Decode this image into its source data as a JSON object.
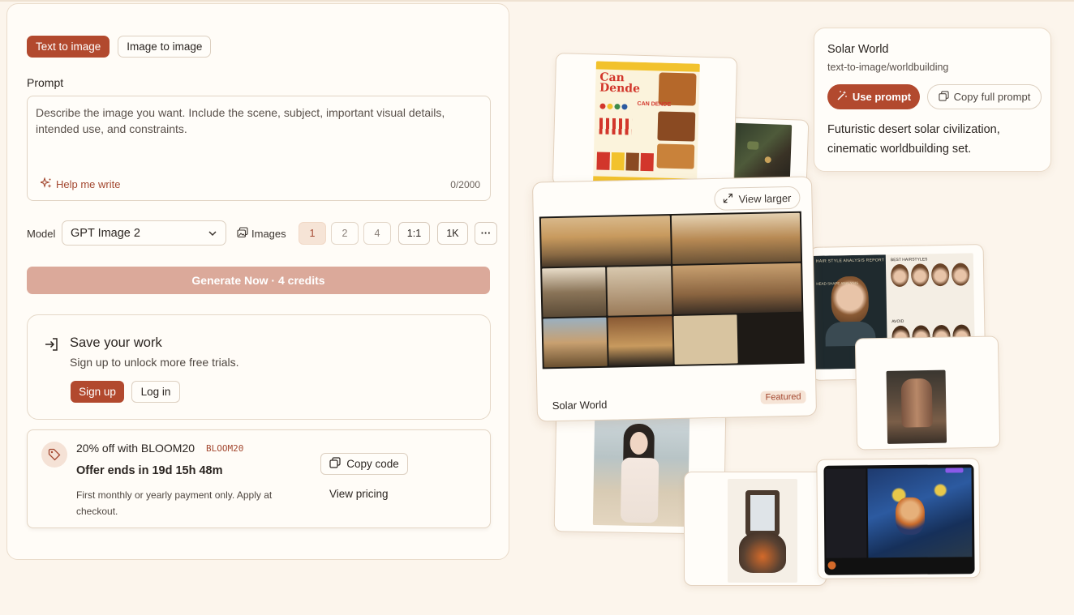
{
  "tabs": [
    {
      "label": "Text to image",
      "active": true
    },
    {
      "label": "Image to image",
      "active": false
    }
  ],
  "prompt": {
    "label": "Prompt",
    "placeholder": "Describe the image you want. Include the scene, subject, important visual details, intended use, and constraints.",
    "help_label": "Help me write",
    "counter": "0/2000"
  },
  "model": {
    "label": "Model",
    "selected": "GPT Image 2",
    "images_label": "Images",
    "counts": [
      "1",
      "2",
      "4"
    ],
    "selected_count": "1",
    "aspect": "1:1",
    "resolution": "1K",
    "more": "···"
  },
  "generate": {
    "label": "Generate Now · 4 credits"
  },
  "save_card": {
    "title": "Save your work",
    "subtitle": "Sign up to unlock more free trials.",
    "signup_label": "Sign up",
    "login_label": "Log in"
  },
  "promo": {
    "title": "20% off with BLOOM20",
    "code": "BLOOM20",
    "ends": "Offer ends in 19d 15h 48m",
    "note": "First monthly or yearly payment only. Apply at checkout.",
    "copy_label": "Copy code",
    "pricing_label": "View pricing"
  },
  "gallery": {
    "featured": {
      "title": "Solar World",
      "badge": "Featured",
      "view_larger": "View larger"
    },
    "poster_lettering": [
      "Can Dende",
      "CAN DENDE"
    ],
    "hair_lettering": [
      "HAIR STYLE ANALYSIS REPORT",
      "BEST HAIRSTYLES",
      "HEAD SHAPE ANALYSIS",
      "AVOID"
    ]
  },
  "info_card": {
    "title": "Solar World",
    "path": "text-to-image/worldbuilding",
    "use_prompt": "Use prompt",
    "copy_full_prompt": "Copy full prompt",
    "description": "Futuristic desert solar civilization, cinematic worldbuilding set."
  },
  "colors": {
    "accent": "#b2492e",
    "accent_soft": "#f6e4d6",
    "background": "#fcf5ec",
    "generate_disabled": "#dba99a"
  }
}
